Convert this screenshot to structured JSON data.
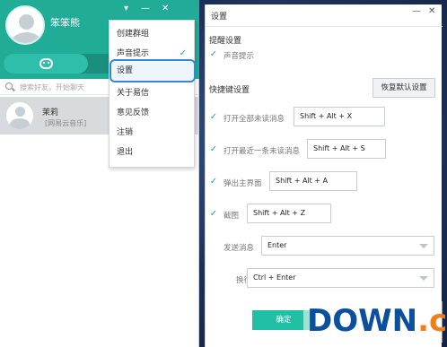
{
  "main": {
    "username": "笨笨熊",
    "window_buttons": {
      "dropdown": "▾",
      "min": "—",
      "close": "✕"
    },
    "search_placeholder": "搜索好友，开始聊天",
    "contact": {
      "name": "茉莉",
      "subtitle": "[网易云音乐]"
    }
  },
  "menu": {
    "items": [
      "创建群组",
      "声音提示",
      "设置",
      "关于易信",
      "意见反馈",
      "注销",
      "退出"
    ],
    "check": "✓",
    "highlighted": "设置"
  },
  "settings": {
    "title": "设置",
    "min": "—",
    "close": "✕",
    "notify_section": "提醒设置",
    "sound_label": "声音提示",
    "shortcut_section": "快捷键设置",
    "restore_button": "恢复默认设置",
    "shortcuts": [
      {
        "label": "打开全部未读消息",
        "key": "Shift + Alt + X"
      },
      {
        "label": "打开最近一条未读消息",
        "key": "Shift + Alt + S"
      },
      {
        "label": "弹出主界面",
        "key": "Shift + Alt + A"
      },
      {
        "label": "截图",
        "key": "Shift + Alt + Z"
      }
    ],
    "send_label": "发送消息",
    "send_value": "Enter",
    "newline_label": "换行",
    "newline_value": "Ctrl + Enter",
    "ok_button": "确定",
    "check": "✓"
  },
  "watermark": {
    "main": "DOWN",
    "accent": ".cc"
  },
  "colors": {
    "brand": "#21ac98",
    "highlight": "#3a86d4",
    "ok": "#21c0a4"
  }
}
